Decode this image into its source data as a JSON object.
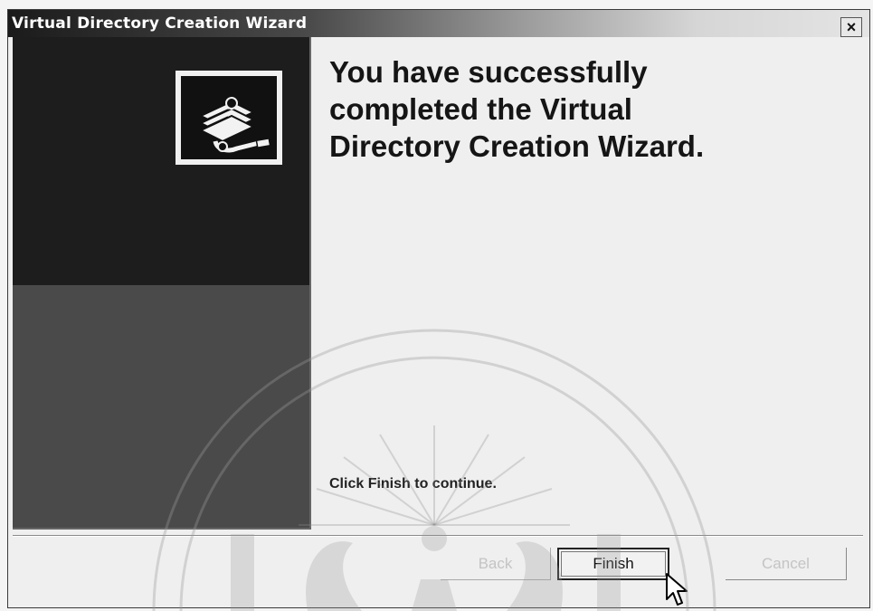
{
  "window": {
    "title": "Virtual Directory Creation Wizard",
    "close_label": "×"
  },
  "main": {
    "heading_lines": [
      "You have successfully",
      "completed the Virtual",
      "Directory Creation Wizard."
    ],
    "hint": "Click Finish to continue."
  },
  "buttons": {
    "back": "Back",
    "finish": "Finish",
    "cancel": "Cancel"
  },
  "icons": {
    "wizard": "books-with-pen-icon",
    "cursor": "mouse-pointer-icon",
    "watermark": "university-seal-watermark"
  }
}
